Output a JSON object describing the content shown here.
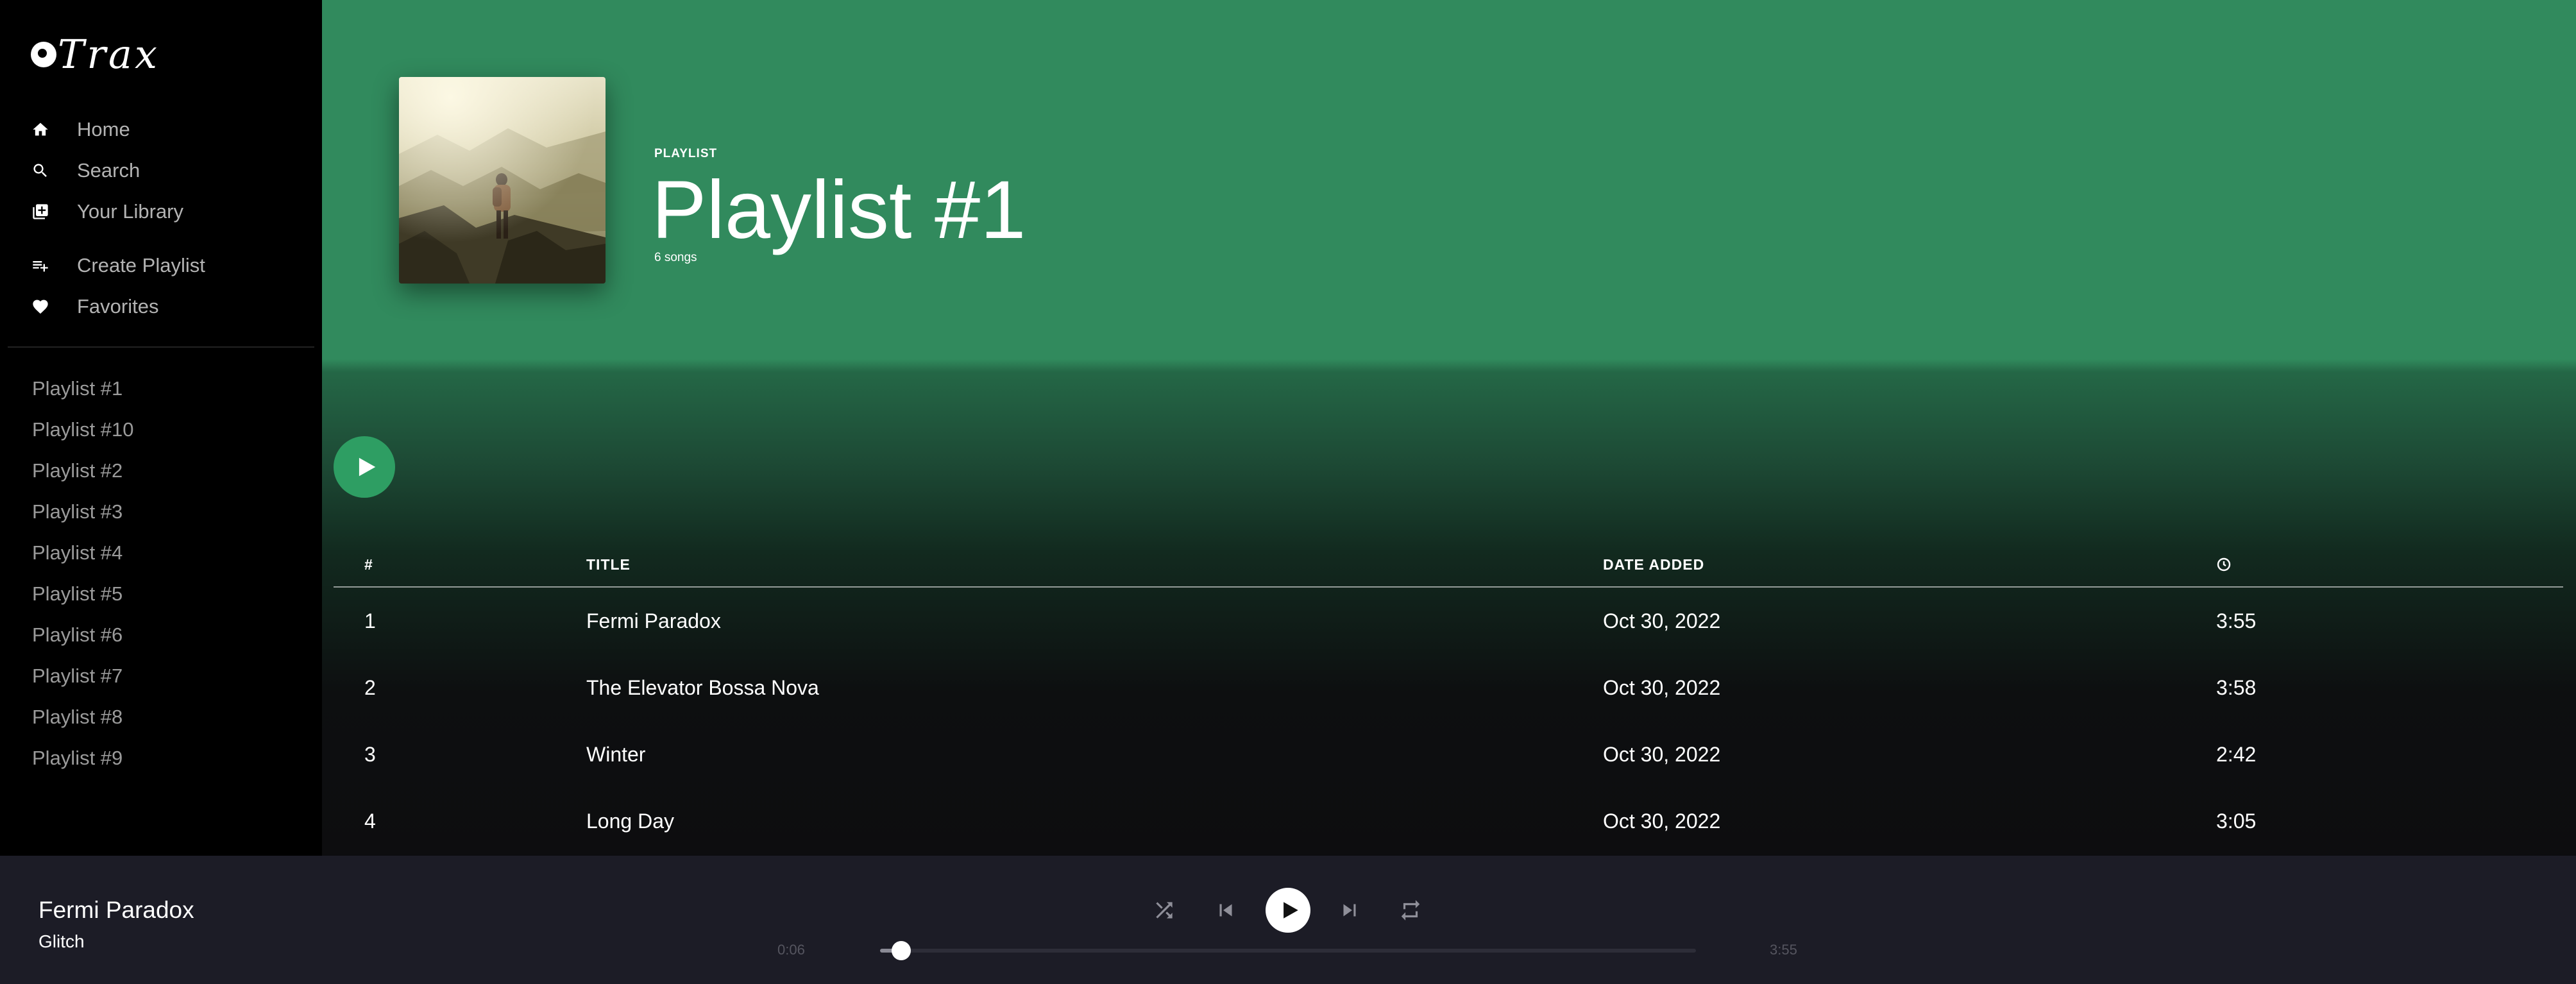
{
  "app": {
    "logo_text": "Trax"
  },
  "sidebar": {
    "nav": [
      {
        "label": "Home",
        "icon": "home-icon"
      },
      {
        "label": "Search",
        "icon": "search-icon"
      },
      {
        "label": "Your Library",
        "icon": "library-icon"
      }
    ],
    "actions": [
      {
        "label": "Create Playlist",
        "icon": "playlist-add-icon"
      },
      {
        "label": "Favorites",
        "icon": "heart-icon"
      }
    ],
    "playlists": [
      "Playlist #1",
      "Playlist #10",
      "Playlist #2",
      "Playlist #3",
      "Playlist #4",
      "Playlist #5",
      "Playlist #6",
      "Playlist #7",
      "Playlist #8",
      "Playlist #9"
    ]
  },
  "header": {
    "type_label": "PLAYLIST",
    "title": "Playlist #1",
    "count": "6 songs",
    "accent_color": "#318a5d"
  },
  "table": {
    "columns": [
      "#",
      "TITLE",
      "DATE ADDED"
    ],
    "duration_icon": "clock-icon",
    "rows": [
      {
        "num": "1",
        "title": "Fermi Paradox",
        "date": "Oct 30, 2022",
        "duration": "3:55"
      },
      {
        "num": "2",
        "title": "The Elevator Bossa Nova",
        "date": "Oct 30, 2022",
        "duration": "3:58"
      },
      {
        "num": "3",
        "title": "Winter",
        "date": "Oct 30, 2022",
        "duration": "2:42"
      },
      {
        "num": "4",
        "title": "Long Day",
        "date": "Oct 30, 2022",
        "duration": "3:05"
      }
    ]
  },
  "player": {
    "title": "Fermi Paradox",
    "artist": "Glitch",
    "elapsed": "0:06",
    "total": "3:55",
    "progress": 0.026
  }
}
